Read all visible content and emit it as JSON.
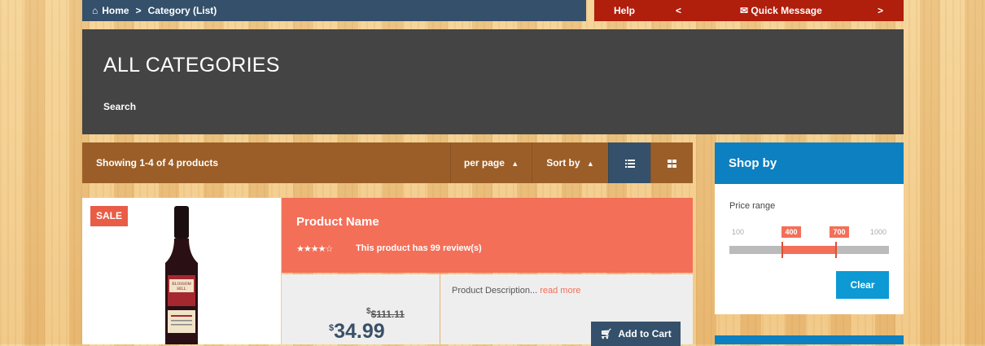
{
  "breadcrumb": {
    "home": "Home",
    "current": "Category (List)"
  },
  "topbar": {
    "help": "Help",
    "prev": "<",
    "quick_message": "Quick Message",
    "next": ">"
  },
  "hero": {
    "title": "ALL CATEGORIES",
    "search": "Search"
  },
  "toolbar": {
    "count": "Showing 1-4 of 4 products",
    "per_page": "per page",
    "sort_by": "Sort by"
  },
  "product": {
    "badge": "SALE",
    "name": "Product Name",
    "rating": 4,
    "rating_max": 5,
    "stars_text": "★★★★☆",
    "reviews": "This product has 99 review(s)",
    "old_price_currency": "$",
    "old_price": "$111.11",
    "price_currency": "$",
    "price": "34.99",
    "description": "Product Description...",
    "read_more": "read more",
    "add_to_cart": "Add to Cart",
    "wine_label": "BLOSSOM HILL"
  },
  "sidebar": {
    "title": "Shop by",
    "price_range_label": "Price range",
    "range_min": "100",
    "range_low": "400",
    "range_high": "700",
    "range_max": "1000",
    "clear": "Clear"
  },
  "colors": {
    "blue_dark": "#34506b",
    "red": "#b01e0c",
    "salmon": "#f36f58",
    "brown": "#9b5e28",
    "blue": "#0c80c1"
  }
}
